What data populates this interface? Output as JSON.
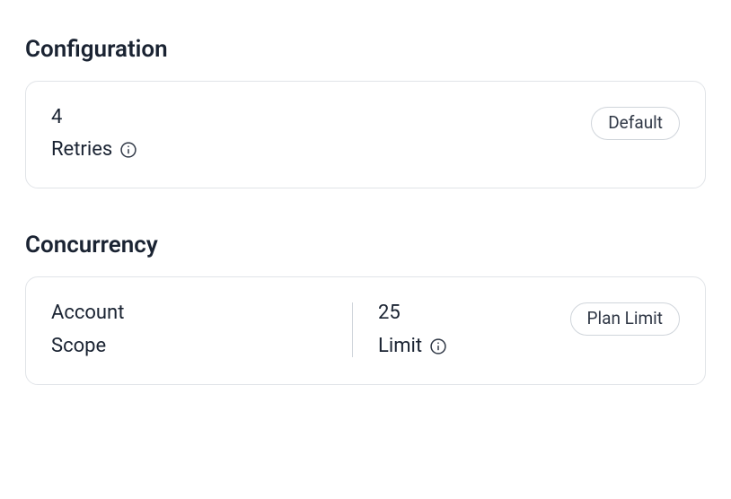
{
  "configuration": {
    "title": "Configuration",
    "retries": {
      "value": "4",
      "label": "Retries",
      "badge": "Default"
    }
  },
  "concurrency": {
    "title": "Concurrency",
    "scope": {
      "value": "Account",
      "label": "Scope"
    },
    "limit": {
      "value": "25",
      "label": "Limit",
      "badge": "Plan Limit"
    }
  }
}
